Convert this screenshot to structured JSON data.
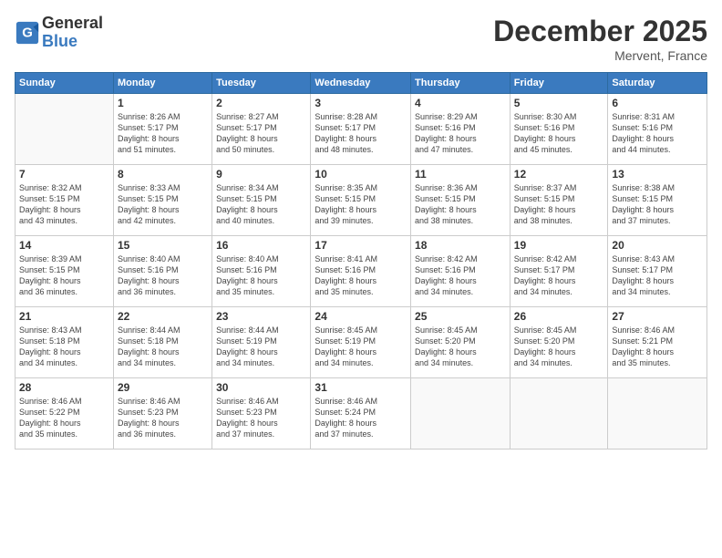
{
  "logo": {
    "general": "General",
    "blue": "Blue"
  },
  "header": {
    "month": "December 2025",
    "location": "Mervent, France"
  },
  "weekdays": [
    "Sunday",
    "Monday",
    "Tuesday",
    "Wednesday",
    "Thursday",
    "Friday",
    "Saturday"
  ],
  "weeks": [
    [
      {
        "day": "",
        "info": ""
      },
      {
        "day": "1",
        "info": "Sunrise: 8:26 AM\nSunset: 5:17 PM\nDaylight: 8 hours\nand 51 minutes."
      },
      {
        "day": "2",
        "info": "Sunrise: 8:27 AM\nSunset: 5:17 PM\nDaylight: 8 hours\nand 50 minutes."
      },
      {
        "day": "3",
        "info": "Sunrise: 8:28 AM\nSunset: 5:17 PM\nDaylight: 8 hours\nand 48 minutes."
      },
      {
        "day": "4",
        "info": "Sunrise: 8:29 AM\nSunset: 5:16 PM\nDaylight: 8 hours\nand 47 minutes."
      },
      {
        "day": "5",
        "info": "Sunrise: 8:30 AM\nSunset: 5:16 PM\nDaylight: 8 hours\nand 45 minutes."
      },
      {
        "day": "6",
        "info": "Sunrise: 8:31 AM\nSunset: 5:16 PM\nDaylight: 8 hours\nand 44 minutes."
      }
    ],
    [
      {
        "day": "7",
        "info": "Sunrise: 8:32 AM\nSunset: 5:15 PM\nDaylight: 8 hours\nand 43 minutes."
      },
      {
        "day": "8",
        "info": "Sunrise: 8:33 AM\nSunset: 5:15 PM\nDaylight: 8 hours\nand 42 minutes."
      },
      {
        "day": "9",
        "info": "Sunrise: 8:34 AM\nSunset: 5:15 PM\nDaylight: 8 hours\nand 40 minutes."
      },
      {
        "day": "10",
        "info": "Sunrise: 8:35 AM\nSunset: 5:15 PM\nDaylight: 8 hours\nand 39 minutes."
      },
      {
        "day": "11",
        "info": "Sunrise: 8:36 AM\nSunset: 5:15 PM\nDaylight: 8 hours\nand 38 minutes."
      },
      {
        "day": "12",
        "info": "Sunrise: 8:37 AM\nSunset: 5:15 PM\nDaylight: 8 hours\nand 38 minutes."
      },
      {
        "day": "13",
        "info": "Sunrise: 8:38 AM\nSunset: 5:15 PM\nDaylight: 8 hours\nand 37 minutes."
      }
    ],
    [
      {
        "day": "14",
        "info": "Sunrise: 8:39 AM\nSunset: 5:15 PM\nDaylight: 8 hours\nand 36 minutes."
      },
      {
        "day": "15",
        "info": "Sunrise: 8:40 AM\nSunset: 5:16 PM\nDaylight: 8 hours\nand 36 minutes."
      },
      {
        "day": "16",
        "info": "Sunrise: 8:40 AM\nSunset: 5:16 PM\nDaylight: 8 hours\nand 35 minutes."
      },
      {
        "day": "17",
        "info": "Sunrise: 8:41 AM\nSunset: 5:16 PM\nDaylight: 8 hours\nand 35 minutes."
      },
      {
        "day": "18",
        "info": "Sunrise: 8:42 AM\nSunset: 5:16 PM\nDaylight: 8 hours\nand 34 minutes."
      },
      {
        "day": "19",
        "info": "Sunrise: 8:42 AM\nSunset: 5:17 PM\nDaylight: 8 hours\nand 34 minutes."
      },
      {
        "day": "20",
        "info": "Sunrise: 8:43 AM\nSunset: 5:17 PM\nDaylight: 8 hours\nand 34 minutes."
      }
    ],
    [
      {
        "day": "21",
        "info": "Sunrise: 8:43 AM\nSunset: 5:18 PM\nDaylight: 8 hours\nand 34 minutes."
      },
      {
        "day": "22",
        "info": "Sunrise: 8:44 AM\nSunset: 5:18 PM\nDaylight: 8 hours\nand 34 minutes."
      },
      {
        "day": "23",
        "info": "Sunrise: 8:44 AM\nSunset: 5:19 PM\nDaylight: 8 hours\nand 34 minutes."
      },
      {
        "day": "24",
        "info": "Sunrise: 8:45 AM\nSunset: 5:19 PM\nDaylight: 8 hours\nand 34 minutes."
      },
      {
        "day": "25",
        "info": "Sunrise: 8:45 AM\nSunset: 5:20 PM\nDaylight: 8 hours\nand 34 minutes."
      },
      {
        "day": "26",
        "info": "Sunrise: 8:45 AM\nSunset: 5:20 PM\nDaylight: 8 hours\nand 34 minutes."
      },
      {
        "day": "27",
        "info": "Sunrise: 8:46 AM\nSunset: 5:21 PM\nDaylight: 8 hours\nand 35 minutes."
      }
    ],
    [
      {
        "day": "28",
        "info": "Sunrise: 8:46 AM\nSunset: 5:22 PM\nDaylight: 8 hours\nand 35 minutes."
      },
      {
        "day": "29",
        "info": "Sunrise: 8:46 AM\nSunset: 5:23 PM\nDaylight: 8 hours\nand 36 minutes."
      },
      {
        "day": "30",
        "info": "Sunrise: 8:46 AM\nSunset: 5:23 PM\nDaylight: 8 hours\nand 37 minutes."
      },
      {
        "day": "31",
        "info": "Sunrise: 8:46 AM\nSunset: 5:24 PM\nDaylight: 8 hours\nand 37 minutes."
      },
      {
        "day": "",
        "info": ""
      },
      {
        "day": "",
        "info": ""
      },
      {
        "day": "",
        "info": ""
      }
    ]
  ]
}
